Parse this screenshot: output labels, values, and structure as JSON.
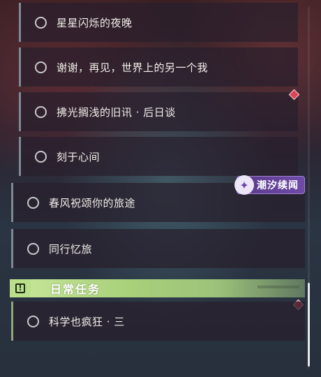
{
  "quests": [
    {
      "label": "星星闪烁的夜晚"
    },
    {
      "label": "谢谢，再见，世界上的另一个我"
    },
    {
      "label": "拂光搁浅的旧讯 · 后日谈"
    },
    {
      "label": "刻于心间"
    },
    {
      "label": "春风祝颂你的旅途"
    },
    {
      "label": "同行忆旅"
    }
  ],
  "badge": {
    "icon": "spiral-icon",
    "label": "潮汐续闻",
    "color": "#6e4aa6"
  },
  "daily_section": {
    "icon": "exclamation-box-icon",
    "title": "日常任务",
    "color": "#a9d07a"
  },
  "daily_quests": [
    {
      "label": "科学也疯狂 · 三"
    }
  ],
  "markers": {
    "color": "#d9455a"
  }
}
